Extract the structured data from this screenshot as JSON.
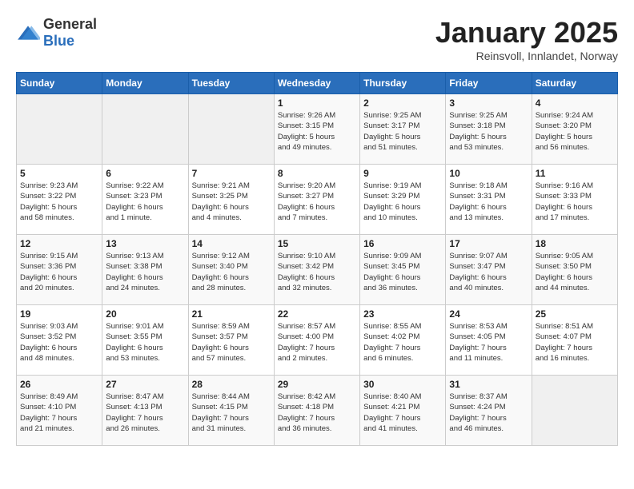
{
  "logo": {
    "general": "General",
    "blue": "Blue"
  },
  "header": {
    "title": "January 2025",
    "subtitle": "Reinsvoll, Innlandet, Norway"
  },
  "weekdays": [
    "Sunday",
    "Monday",
    "Tuesday",
    "Wednesday",
    "Thursday",
    "Friday",
    "Saturday"
  ],
  "weeks": [
    [
      {
        "day": "",
        "content": ""
      },
      {
        "day": "",
        "content": ""
      },
      {
        "day": "",
        "content": ""
      },
      {
        "day": "1",
        "content": "Sunrise: 9:26 AM\nSunset: 3:15 PM\nDaylight: 5 hours\nand 49 minutes."
      },
      {
        "day": "2",
        "content": "Sunrise: 9:25 AM\nSunset: 3:17 PM\nDaylight: 5 hours\nand 51 minutes."
      },
      {
        "day": "3",
        "content": "Sunrise: 9:25 AM\nSunset: 3:18 PM\nDaylight: 5 hours\nand 53 minutes."
      },
      {
        "day": "4",
        "content": "Sunrise: 9:24 AM\nSunset: 3:20 PM\nDaylight: 5 hours\nand 56 minutes."
      }
    ],
    [
      {
        "day": "5",
        "content": "Sunrise: 9:23 AM\nSunset: 3:22 PM\nDaylight: 5 hours\nand 58 minutes."
      },
      {
        "day": "6",
        "content": "Sunrise: 9:22 AM\nSunset: 3:23 PM\nDaylight: 6 hours\nand 1 minute."
      },
      {
        "day": "7",
        "content": "Sunrise: 9:21 AM\nSunset: 3:25 PM\nDaylight: 6 hours\nand 4 minutes."
      },
      {
        "day": "8",
        "content": "Sunrise: 9:20 AM\nSunset: 3:27 PM\nDaylight: 6 hours\nand 7 minutes."
      },
      {
        "day": "9",
        "content": "Sunrise: 9:19 AM\nSunset: 3:29 PM\nDaylight: 6 hours\nand 10 minutes."
      },
      {
        "day": "10",
        "content": "Sunrise: 9:18 AM\nSunset: 3:31 PM\nDaylight: 6 hours\nand 13 minutes."
      },
      {
        "day": "11",
        "content": "Sunrise: 9:16 AM\nSunset: 3:33 PM\nDaylight: 6 hours\nand 17 minutes."
      }
    ],
    [
      {
        "day": "12",
        "content": "Sunrise: 9:15 AM\nSunset: 3:36 PM\nDaylight: 6 hours\nand 20 minutes."
      },
      {
        "day": "13",
        "content": "Sunrise: 9:13 AM\nSunset: 3:38 PM\nDaylight: 6 hours\nand 24 minutes."
      },
      {
        "day": "14",
        "content": "Sunrise: 9:12 AM\nSunset: 3:40 PM\nDaylight: 6 hours\nand 28 minutes."
      },
      {
        "day": "15",
        "content": "Sunrise: 9:10 AM\nSunset: 3:42 PM\nDaylight: 6 hours\nand 32 minutes."
      },
      {
        "day": "16",
        "content": "Sunrise: 9:09 AM\nSunset: 3:45 PM\nDaylight: 6 hours\nand 36 minutes."
      },
      {
        "day": "17",
        "content": "Sunrise: 9:07 AM\nSunset: 3:47 PM\nDaylight: 6 hours\nand 40 minutes."
      },
      {
        "day": "18",
        "content": "Sunrise: 9:05 AM\nSunset: 3:50 PM\nDaylight: 6 hours\nand 44 minutes."
      }
    ],
    [
      {
        "day": "19",
        "content": "Sunrise: 9:03 AM\nSunset: 3:52 PM\nDaylight: 6 hours\nand 48 minutes."
      },
      {
        "day": "20",
        "content": "Sunrise: 9:01 AM\nSunset: 3:55 PM\nDaylight: 6 hours\nand 53 minutes."
      },
      {
        "day": "21",
        "content": "Sunrise: 8:59 AM\nSunset: 3:57 PM\nDaylight: 6 hours\nand 57 minutes."
      },
      {
        "day": "22",
        "content": "Sunrise: 8:57 AM\nSunset: 4:00 PM\nDaylight: 7 hours\nand 2 minutes."
      },
      {
        "day": "23",
        "content": "Sunrise: 8:55 AM\nSunset: 4:02 PM\nDaylight: 7 hours\nand 6 minutes."
      },
      {
        "day": "24",
        "content": "Sunrise: 8:53 AM\nSunset: 4:05 PM\nDaylight: 7 hours\nand 11 minutes."
      },
      {
        "day": "25",
        "content": "Sunrise: 8:51 AM\nSunset: 4:07 PM\nDaylight: 7 hours\nand 16 minutes."
      }
    ],
    [
      {
        "day": "26",
        "content": "Sunrise: 8:49 AM\nSunset: 4:10 PM\nDaylight: 7 hours\nand 21 minutes."
      },
      {
        "day": "27",
        "content": "Sunrise: 8:47 AM\nSunset: 4:13 PM\nDaylight: 7 hours\nand 26 minutes."
      },
      {
        "day": "28",
        "content": "Sunrise: 8:44 AM\nSunset: 4:15 PM\nDaylight: 7 hours\nand 31 minutes."
      },
      {
        "day": "29",
        "content": "Sunrise: 8:42 AM\nSunset: 4:18 PM\nDaylight: 7 hours\nand 36 minutes."
      },
      {
        "day": "30",
        "content": "Sunrise: 8:40 AM\nSunset: 4:21 PM\nDaylight: 7 hours\nand 41 minutes."
      },
      {
        "day": "31",
        "content": "Sunrise: 8:37 AM\nSunset: 4:24 PM\nDaylight: 7 hours\nand 46 minutes."
      },
      {
        "day": "",
        "content": ""
      }
    ]
  ]
}
